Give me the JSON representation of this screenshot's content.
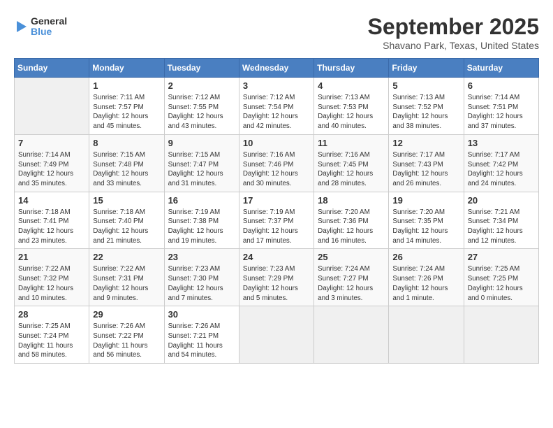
{
  "header": {
    "logo": {
      "line1": "General",
      "line2": "Blue"
    },
    "title": "September 2025",
    "subtitle": "Shavano Park, Texas, United States"
  },
  "days_of_week": [
    "Sunday",
    "Monday",
    "Tuesday",
    "Wednesday",
    "Thursday",
    "Friday",
    "Saturday"
  ],
  "weeks": [
    [
      {
        "num": "",
        "sunrise": "",
        "sunset": "",
        "daylight": "",
        "empty": true
      },
      {
        "num": "1",
        "sunrise": "Sunrise: 7:11 AM",
        "sunset": "Sunset: 7:57 PM",
        "daylight": "Daylight: 12 hours and 45 minutes."
      },
      {
        "num": "2",
        "sunrise": "Sunrise: 7:12 AM",
        "sunset": "Sunset: 7:55 PM",
        "daylight": "Daylight: 12 hours and 43 minutes."
      },
      {
        "num": "3",
        "sunrise": "Sunrise: 7:12 AM",
        "sunset": "Sunset: 7:54 PM",
        "daylight": "Daylight: 12 hours and 42 minutes."
      },
      {
        "num": "4",
        "sunrise": "Sunrise: 7:13 AM",
        "sunset": "Sunset: 7:53 PM",
        "daylight": "Daylight: 12 hours and 40 minutes."
      },
      {
        "num": "5",
        "sunrise": "Sunrise: 7:13 AM",
        "sunset": "Sunset: 7:52 PM",
        "daylight": "Daylight: 12 hours and 38 minutes."
      },
      {
        "num": "6",
        "sunrise": "Sunrise: 7:14 AM",
        "sunset": "Sunset: 7:51 PM",
        "daylight": "Daylight: 12 hours and 37 minutes."
      }
    ],
    [
      {
        "num": "7",
        "sunrise": "Sunrise: 7:14 AM",
        "sunset": "Sunset: 7:49 PM",
        "daylight": "Daylight: 12 hours and 35 minutes."
      },
      {
        "num": "8",
        "sunrise": "Sunrise: 7:15 AM",
        "sunset": "Sunset: 7:48 PM",
        "daylight": "Daylight: 12 hours and 33 minutes."
      },
      {
        "num": "9",
        "sunrise": "Sunrise: 7:15 AM",
        "sunset": "Sunset: 7:47 PM",
        "daylight": "Daylight: 12 hours and 31 minutes."
      },
      {
        "num": "10",
        "sunrise": "Sunrise: 7:16 AM",
        "sunset": "Sunset: 7:46 PM",
        "daylight": "Daylight: 12 hours and 30 minutes."
      },
      {
        "num": "11",
        "sunrise": "Sunrise: 7:16 AM",
        "sunset": "Sunset: 7:45 PM",
        "daylight": "Daylight: 12 hours and 28 minutes."
      },
      {
        "num": "12",
        "sunrise": "Sunrise: 7:17 AM",
        "sunset": "Sunset: 7:43 PM",
        "daylight": "Daylight: 12 hours and 26 minutes."
      },
      {
        "num": "13",
        "sunrise": "Sunrise: 7:17 AM",
        "sunset": "Sunset: 7:42 PM",
        "daylight": "Daylight: 12 hours and 24 minutes."
      }
    ],
    [
      {
        "num": "14",
        "sunrise": "Sunrise: 7:18 AM",
        "sunset": "Sunset: 7:41 PM",
        "daylight": "Daylight: 12 hours and 23 minutes."
      },
      {
        "num": "15",
        "sunrise": "Sunrise: 7:18 AM",
        "sunset": "Sunset: 7:40 PM",
        "daylight": "Daylight: 12 hours and 21 minutes."
      },
      {
        "num": "16",
        "sunrise": "Sunrise: 7:19 AM",
        "sunset": "Sunset: 7:38 PM",
        "daylight": "Daylight: 12 hours and 19 minutes."
      },
      {
        "num": "17",
        "sunrise": "Sunrise: 7:19 AM",
        "sunset": "Sunset: 7:37 PM",
        "daylight": "Daylight: 12 hours and 17 minutes."
      },
      {
        "num": "18",
        "sunrise": "Sunrise: 7:20 AM",
        "sunset": "Sunset: 7:36 PM",
        "daylight": "Daylight: 12 hours and 16 minutes."
      },
      {
        "num": "19",
        "sunrise": "Sunrise: 7:20 AM",
        "sunset": "Sunset: 7:35 PM",
        "daylight": "Daylight: 12 hours and 14 minutes."
      },
      {
        "num": "20",
        "sunrise": "Sunrise: 7:21 AM",
        "sunset": "Sunset: 7:34 PM",
        "daylight": "Daylight: 12 hours and 12 minutes."
      }
    ],
    [
      {
        "num": "21",
        "sunrise": "Sunrise: 7:22 AM",
        "sunset": "Sunset: 7:32 PM",
        "daylight": "Daylight: 12 hours and 10 minutes."
      },
      {
        "num": "22",
        "sunrise": "Sunrise: 7:22 AM",
        "sunset": "Sunset: 7:31 PM",
        "daylight": "Daylight: 12 hours and 9 minutes."
      },
      {
        "num": "23",
        "sunrise": "Sunrise: 7:23 AM",
        "sunset": "Sunset: 7:30 PM",
        "daylight": "Daylight: 12 hours and 7 minutes."
      },
      {
        "num": "24",
        "sunrise": "Sunrise: 7:23 AM",
        "sunset": "Sunset: 7:29 PM",
        "daylight": "Daylight: 12 hours and 5 minutes."
      },
      {
        "num": "25",
        "sunrise": "Sunrise: 7:24 AM",
        "sunset": "Sunset: 7:27 PM",
        "daylight": "Daylight: 12 hours and 3 minutes."
      },
      {
        "num": "26",
        "sunrise": "Sunrise: 7:24 AM",
        "sunset": "Sunset: 7:26 PM",
        "daylight": "Daylight: 12 hours and 1 minute."
      },
      {
        "num": "27",
        "sunrise": "Sunrise: 7:25 AM",
        "sunset": "Sunset: 7:25 PM",
        "daylight": "Daylight: 12 hours and 0 minutes."
      }
    ],
    [
      {
        "num": "28",
        "sunrise": "Sunrise: 7:25 AM",
        "sunset": "Sunset: 7:24 PM",
        "daylight": "Daylight: 11 hours and 58 minutes."
      },
      {
        "num": "29",
        "sunrise": "Sunrise: 7:26 AM",
        "sunset": "Sunset: 7:22 PM",
        "daylight": "Daylight: 11 hours and 56 minutes."
      },
      {
        "num": "30",
        "sunrise": "Sunrise: 7:26 AM",
        "sunset": "Sunset: 7:21 PM",
        "daylight": "Daylight: 11 hours and 54 minutes."
      },
      {
        "num": "",
        "sunrise": "",
        "sunset": "",
        "daylight": "",
        "empty": true
      },
      {
        "num": "",
        "sunrise": "",
        "sunset": "",
        "daylight": "",
        "empty": true
      },
      {
        "num": "",
        "sunrise": "",
        "sunset": "",
        "daylight": "",
        "empty": true
      },
      {
        "num": "",
        "sunrise": "",
        "sunset": "",
        "daylight": "",
        "empty": true
      }
    ]
  ]
}
